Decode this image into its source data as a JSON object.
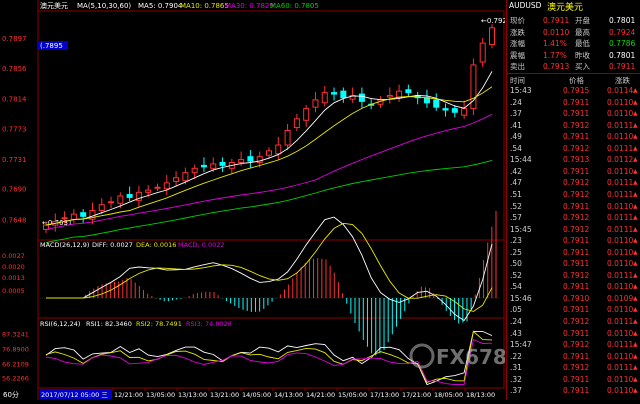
{
  "chart_header": {
    "symbol_label": "澳元美元",
    "ma_label": "MA(5,10,30,60)",
    "ma5": "MA5: 0.7904",
    "ma10": "MA10: 0.7865",
    "ma30": "MA30: 0.7829",
    "ma60": "MA60: 0.7805"
  },
  "price_axis": {
    "labels": [
      "0.7897",
      "0.7856",
      "0.7814",
      "0.7773",
      "0.7731",
      "0.7690",
      "0.7648"
    ],
    "current_tag": "(.7895",
    "high_tag": "←0.7924",
    "low_tag": "←0.7631"
  },
  "macd_header": {
    "label": "MACD(26,12,9)",
    "diff": "DIFF: 0.0027",
    "dea": "DEA: 0.0016",
    "macd": "MACD: 0.0022",
    "axis": [
      "0.0027",
      "0.0020",
      "0.0013",
      "0.0005"
    ]
  },
  "rsi_header": {
    "label": "RSI(6,12,24)",
    "rsi1": "RSI1: 82.3460",
    "rsi2": "RSI2: 78.7491",
    "rsi3": "RSI3: 74.8028",
    "axis": [
      "87.3241",
      "76.8900",
      "66.2109",
      "56.2266"
    ]
  },
  "time_axis": {
    "period": "60分",
    "cursor_date": "2017/07/12 05:00 三",
    "labels": [
      "12/21:00",
      "13/05:00",
      "13/13:00",
      "13/21:00",
      "14/05:00",
      "14/13:00",
      "14/21:00",
      "15/05:00",
      "17/13:00",
      "17/21:00",
      "18/05:00",
      "18/13:00"
    ]
  },
  "watermark": "FX678 汇通",
  "quote": {
    "title_code": "AUDUSD",
    "title_name": "澳元美元",
    "rows": [
      {
        "l1": "现价",
        "v1": "0.7911",
        "c1": "red",
        "l2": "开盘",
        "v2": "0.7801",
        "c2": "wht"
      },
      {
        "l1": "涨跌",
        "v1": "0.0110",
        "c1": "red",
        "l2": "最高",
        "v2": "0.7924",
        "c2": "red"
      },
      {
        "l1": "涨幅",
        "v1": "1.41%",
        "c1": "red",
        "l2": "最低",
        "v2": "0.7786",
        "c2": "grn"
      },
      {
        "l1": "震幅",
        "v1": "1.77%",
        "c1": "red",
        "l2": "昨收",
        "v2": "0.7801",
        "c2": "wht"
      },
      {
        "l1": "卖出",
        "v1": "0.7913",
        "c1": "red",
        "l2": "买入",
        "v2": "0.7911",
        "c2": "red"
      }
    ],
    "tick_headers": [
      "时间",
      "价格",
      "涨跌"
    ],
    "ticks": [
      {
        "t": "15:43",
        "p": "0.7915",
        "c": "0.0114"
      },
      {
        "t": ".24",
        "p": "0.7911",
        "c": "0.0110"
      },
      {
        "t": ".37",
        "p": "0.7911",
        "c": "0.0110"
      },
      {
        "t": ".41",
        "p": "0.7912",
        "c": "0.0111"
      },
      {
        "t": ".49",
        "p": "0.7911",
        "c": "0.0110"
      },
      {
        "t": ".54",
        "p": "0.7912",
        "c": "0.0111"
      },
      {
        "t": "15:44",
        "p": "0.7913",
        "c": "0.0112"
      },
      {
        "t": ".42",
        "p": "0.7911",
        "c": "0.0110"
      },
      {
        "t": ".47",
        "p": "0.7912",
        "c": "0.0111"
      },
      {
        "t": ".51",
        "p": "0.7912",
        "c": "0.0111"
      },
      {
        "t": ".52",
        "p": "0.7911",
        "c": "0.0110"
      },
      {
        "t": ".57",
        "p": "0.7912",
        "c": "0.0111"
      },
      {
        "t": "15:45",
        "p": "0.7912",
        "c": "0.0111"
      },
      {
        "t": ".23",
        "p": "0.7911",
        "c": "0.0110"
      },
      {
        "t": ".25",
        "p": "0.7911",
        "c": "0.0110"
      },
      {
        "t": ".50",
        "p": "0.7911",
        "c": "0.0110"
      },
      {
        "t": ".52",
        "p": "0.7912",
        "c": "0.0111"
      },
      {
        "t": ".54",
        "p": "0.7911",
        "c": "0.0110"
      },
      {
        "t": "15:46",
        "p": "0.7910",
        "c": "0.0109"
      },
      {
        "t": ".05",
        "p": "0.7911",
        "c": "0.0110"
      },
      {
        "t": ".24",
        "p": "0.7912",
        "c": "0.0111"
      },
      {
        "t": ".43",
        "p": "0.7911",
        "c": "0.0110"
      },
      {
        "t": "15:47",
        "p": "0.7912",
        "c": "0.0111"
      },
      {
        "t": ".22",
        "p": "0.7911",
        "c": "0.0110"
      },
      {
        "t": ".31",
        "p": "0.7912",
        "c": "0.0111"
      },
      {
        "t": ".32",
        "p": "0.7911",
        "c": "0.0110"
      },
      {
        "t": ".37",
        "p": "0.7911",
        "c": "0.0110"
      }
    ]
  },
  "colors": {
    "up": "#ff3030",
    "down": "#00ffff",
    "ma5": "#ffffff",
    "ma10": "#e8e800",
    "ma30": "#e000e0",
    "ma60": "#00d000",
    "dea": "#e8e800",
    "axis_border": "#8b0000"
  },
  "chart_data": {
    "type": "candlestick",
    "title": "",
    "timeframe": "60分",
    "price_range": [
      0.7625,
      0.793
    ],
    "candles_close": [
      0.764,
      0.7645,
      0.765,
      0.7655,
      0.7652,
      0.766,
      0.7668,
      0.7672,
      0.768,
      0.7678,
      0.7685,
      0.7688,
      0.7692,
      0.7698,
      0.7705,
      0.7712,
      0.7718,
      0.772,
      0.7724,
      0.7722,
      0.7726,
      0.773,
      0.7728,
      0.7734,
      0.7742,
      0.775,
      0.777,
      0.7786,
      0.78,
      0.7812,
      0.7822,
      0.782,
      0.7815,
      0.7818,
      0.781,
      0.7806,
      0.7812,
      0.7818,
      0.7824,
      0.7822,
      0.7815,
      0.7808,
      0.7802,
      0.7798,
      0.7795,
      0.78,
      0.786,
      0.789,
      0.7911
    ],
    "macd": {
      "diff": 0.0027,
      "dea": 0.0016,
      "macd": 0.0022,
      "ylim": [
        -0.001,
        0.003
      ]
    },
    "rsi": {
      "rsi1": 82.346,
      "rsi2": 78.7491,
      "rsi3": 74.8028,
      "ylim": [
        50,
        90
      ]
    },
    "ma": {
      "ma5": 0.7904,
      "ma10": 0.7865,
      "ma30": 0.7829,
      "ma60": 0.7805
    }
  }
}
